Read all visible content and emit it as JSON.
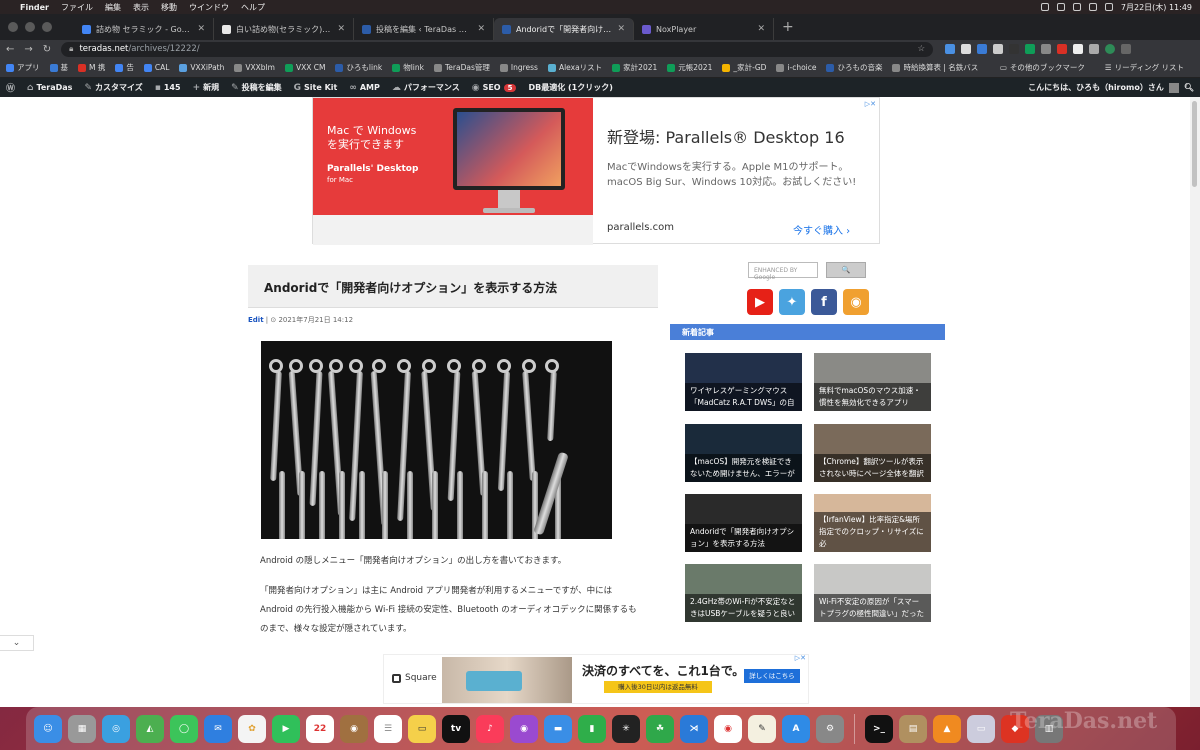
{
  "macbar": {
    "apple": "",
    "items": [
      "Finder",
      "ファイル",
      "編集",
      "表示",
      "移動",
      "ウインドウ",
      "ヘルプ"
    ],
    "clock": "7月22日(木)  11:49"
  },
  "tabs": [
    {
      "title": "詰め物 セラミック - Google 検索",
      "color": "#4285f4"
    },
    {
      "title": "白い詰め物(セラミック)で範囲を広...",
      "color": "#e8e8e8"
    },
    {
      "title": "投稿を編集 ‹ TeraDas — WordPress",
      "color": "#2c5ca8"
    },
    {
      "title": "Andoridで「開発者向けオプショ...",
      "color": "#2c5ca8",
      "active": true
    },
    {
      "title": "NoxPlayer",
      "color": "#6a5acd"
    }
  ],
  "address": {
    "host": "teradas.net",
    "path": "/archives/12222/"
  },
  "bookmarks": [
    {
      "label": "アプリ",
      "color": "#4285f4"
    },
    {
      "label": "基",
      "color": "#3a7bd5"
    },
    {
      "label": "M 携",
      "color": "#d93025"
    },
    {
      "label": "告",
      "color": "#4285f4"
    },
    {
      "label": "CAL",
      "color": "#4285f4"
    },
    {
      "label": "VXXiPath",
      "color": "#5aa0e0"
    },
    {
      "label": "VXXblm",
      "color": "#888"
    },
    {
      "label": "VXX CM",
      "color": "#0f9d58"
    },
    {
      "label": "ひろもlink",
      "color": "#2c5ca8"
    },
    {
      "label": "物link",
      "color": "#0f9d58"
    },
    {
      "label": "TeraDas管理",
      "color": "#888"
    },
    {
      "label": "Ingress",
      "color": "#888"
    },
    {
      "label": "Alexaリスト",
      "color": "#5ab0d0"
    },
    {
      "label": "家計2021",
      "color": "#0f9d58"
    },
    {
      "label": "元帳2021",
      "color": "#0f9d58"
    },
    {
      "label": "_家計-GD",
      "color": "#f4b400"
    },
    {
      "label": "i-choice",
      "color": "#888"
    },
    {
      "label": "ひろもの音楽",
      "color": "#2c5ca8"
    },
    {
      "label": "時給換算表 | 名鉄バス",
      "color": "#888"
    }
  ],
  "bookmarks_right": [
    "その他のブックマーク",
    "リーディング リスト"
  ],
  "wpbar": {
    "items": [
      "TeraDas",
      "カスタマイズ",
      "145",
      "新規",
      "投稿を編集",
      "Site Kit",
      "AMP",
      "パフォーマンス",
      "SEO",
      "DB最適化 (1クリック)"
    ],
    "seo_badge": "5",
    "greeting": "こんにちは、ひろも（hiromo）さん"
  },
  "ad_top": {
    "line1": "Mac で Windows\nを実行できます",
    "brand": "Parallels' Desktop",
    "sub": "for Mac",
    "headline": "新登場: Parallels® Desktop 16",
    "desc": "MacでWindowsを実行する。Apple M1のサポート。macOS Big Sur、Windows 10対応。お試しください!",
    "url": "parallels.com",
    "cta": "今すぐ購入  ›"
  },
  "article": {
    "title": "Andoridで「開発者向けオプション」を表示する方法",
    "edit": "Edit",
    "date": " | ⊙ 2021年7月21日 14:12",
    "p1": "Android の隠しメニュー「開発者向けオプション」の出し方を書いておきます。",
    "p2": "「開発者向けオプション」は主に Android アプリ開発者が利用するメニューですが、中には Android の先行投入機能から Wi-Fi 接続の安定性、Bluetooth のオーディオコデックに関係するものまで、様々な設定が隠されています。"
  },
  "sidebar": {
    "search_placeholder": "ENHANCED BY Google",
    "search_btn": "🔍",
    "new_posts": "新着記事",
    "posts": [
      {
        "caption": "ワイヤレスゲーミングマウス「MadCatz R.A.T DWS」の自",
        "bg": "#22304a"
      },
      {
        "caption": "無料でmacOSのマウス加速・慣性を無効化できるアプリ",
        "bg": "#8a8a86"
      },
      {
        "caption": "【macOS】開発元を検証できないため開けません、エラーが",
        "bg": "#1a2a3a"
      },
      {
        "caption": "【Chrome】翻訳ツールが表示されない時にページ全体を翻訳",
        "bg": "#7a6a5a"
      },
      {
        "caption": "Andoridで「開発者向けオプション」を表示する方法",
        "bg": "#2a2a2a"
      },
      {
        "caption": "【IrfanView】比率指定&場所指定でのクロップ・リサイズに必",
        "bg": "#d6b79a"
      },
      {
        "caption": "2.4GHz帯のWi-Fiが不安定なときはUSBケーブルを疑うと良い",
        "bg": "#6a7a6a"
      },
      {
        "caption": "Wi-Fi不安定の原因が「スマートプラグの極性間違い」だった",
        "bg": "#c8c8c6"
      }
    ]
  },
  "ad_bottom": {
    "brand": "Square",
    "headline": "決済のすべてを、これ1台で。",
    "yellow": "購入後30日以内は返品無料",
    "button": "詳しくはこちら"
  },
  "collapse": "⌄",
  "dock": {
    "calendar_day": "22",
    "watermark": "TeraDas.net"
  },
  "colors": {
    "accent": "#4a7fd8",
    "wp_bar": "#1d2327",
    "browser_dark": "#202124"
  }
}
